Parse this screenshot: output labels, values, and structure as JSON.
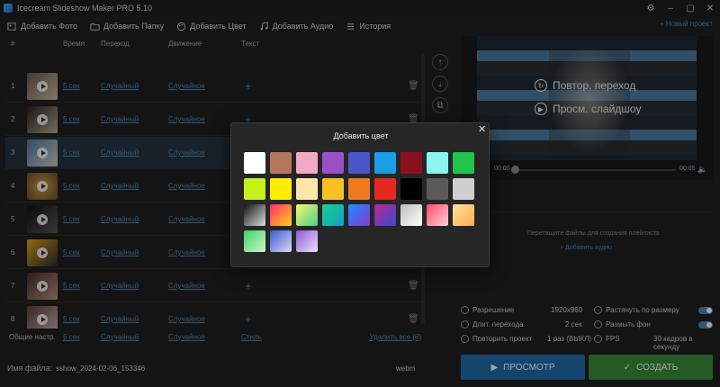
{
  "window": {
    "title": "Icecream Slideshow Maker PRO 5.10",
    "buttons": [
      "⚙",
      "–",
      "▢",
      "✕"
    ]
  },
  "toolbar": {
    "add_photo": "Добавить Фото",
    "add_folder": "Добавить Папку",
    "add_color": "Добавить Цвет",
    "add_audio": "Добавить Аудио",
    "history": "История"
  },
  "table": {
    "headers": {
      "num": "#",
      "time": "Время",
      "transition": "Переход",
      "motion": "Движение",
      "text": "Текст"
    },
    "rows": [
      {
        "num": "1",
        "time": "5 сек",
        "transition": "Случайный",
        "motion": "Случайное"
      },
      {
        "num": "2",
        "time": "5 сек",
        "transition": "Случайный",
        "motion": "Случайное"
      },
      {
        "num": "3",
        "time": "5 сек",
        "transition": "Случайный",
        "motion": "Случайное"
      },
      {
        "num": "4",
        "time": "5 сек",
        "transition": "Случайный",
        "motion": "Случайное"
      },
      {
        "num": "5",
        "time": "5 сек",
        "transition": "Случайный",
        "motion": "Случайное"
      },
      {
        "num": "6",
        "time": "5 сек",
        "transition": "Случайный",
        "motion": "Случайное"
      },
      {
        "num": "7",
        "time": "5 сек",
        "transition": "Случайный",
        "motion": "Случайное"
      },
      {
        "num": "8",
        "time": "5 сек",
        "transition": "Случайный",
        "motion": "Случайное"
      }
    ],
    "common": {
      "label": "Общие настр.",
      "time": "5 сек",
      "transition": "Случайный",
      "motion": "Случайное",
      "style": "Стиль",
      "delete_all": "Удалить все (8)"
    }
  },
  "filebar": {
    "label": "Имя файла:",
    "value": "sshow_2024-02-06_153346",
    "format": "webm"
  },
  "preview": {
    "top_link": "+ Новый проект",
    "repeat_transition": "Повтор. переход",
    "view_slideshow": "Просм. слайдшоу",
    "time_start": "00:00",
    "time_end": "00:05"
  },
  "dropzone": {
    "hint": "Перетащите файлы для создания плейлиста",
    "add": "+ Добавить аудио"
  },
  "settings": {
    "resolution": {
      "label": "Разрешение",
      "value": "1920x960"
    },
    "transition_duration": {
      "label": "Длит. перехода",
      "value": "2 сек"
    },
    "repeat_project": {
      "label": "Повторить проект",
      "value": "1 раз (ВЫКЛ)"
    },
    "stretch": {
      "label": "Растянуть по размеру"
    },
    "blur_bg": {
      "label": "Размыть фон"
    },
    "fps": {
      "label": "FPS",
      "value": "30 кадров в секунду"
    }
  },
  "buttons": {
    "preview": "ПРОСМОТР",
    "create": "СОЗДАТЬ"
  },
  "modal": {
    "title": "Добавить цвет",
    "swatches": [
      "#ffffff",
      "#b5775a",
      "#f2a9c4",
      "#9a4fc8",
      "#4a56c8",
      "#1a9ee8",
      "#8a1020",
      "#8ef4f0",
      "#1fc44a",
      "#c6f01a",
      "#ffee00",
      "#fce6a8",
      "#f8c020",
      "#f07a20",
      "#e42a20",
      "#000000",
      "#5a5a5a",
      "#cfcfcf",
      "linear-gradient(135deg,#111,#ddd)",
      "linear-gradient(135deg,#ff2a6a,#ffd21a)",
      "linear-gradient(135deg,#f9f871,#4ccf8a)",
      "linear-gradient(135deg,#1ad090,#12a0c0)",
      "linear-gradient(135deg,#1a8cff,#8a3ad0)",
      "linear-gradient(135deg,#b82a8a,#3a4ad0)",
      "linear-gradient(135deg,#bdbdbd,#ffffff)",
      "linear-gradient(135deg,#ff4a6a,#fcd2d8)",
      "linear-gradient(135deg,#ffe0a0,#ffb050)",
      "linear-gradient(135deg,#3ad06a,#d2f6c8)",
      "linear-gradient(135deg,#3a5ad0,#d8d8f4)",
      "linear-gradient(135deg,#8a5ad0,#f0e0ff)"
    ]
  }
}
